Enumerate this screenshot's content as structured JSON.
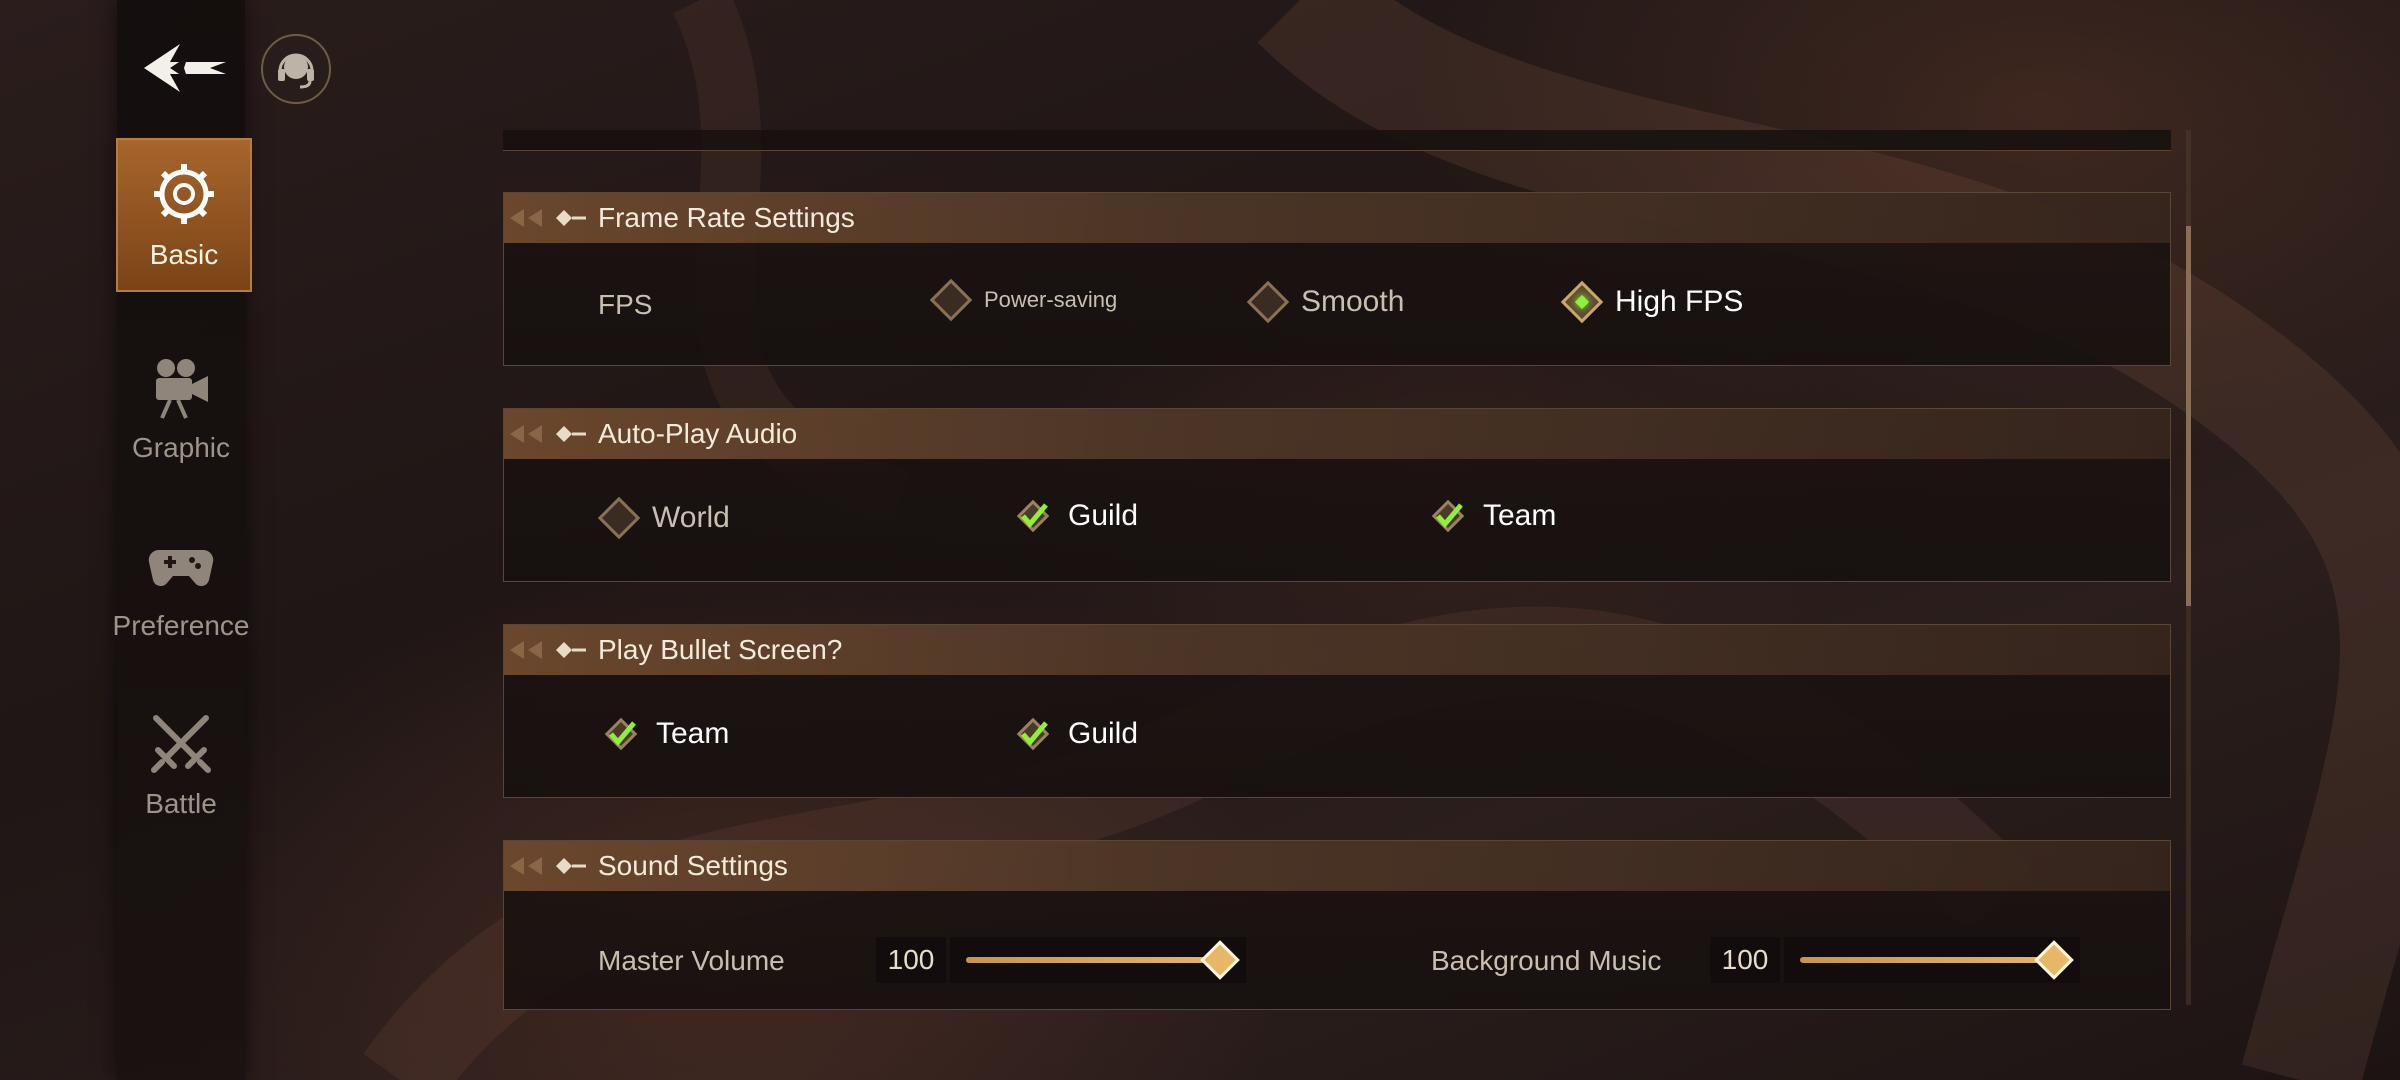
{
  "sidebar": {
    "items": [
      {
        "label": "Basic",
        "icon": "gear-icon",
        "active": true
      },
      {
        "label": "Graphic",
        "icon": "camera-icon",
        "active": false
      },
      {
        "label": "Preference",
        "icon": "gamepad-icon",
        "active": false
      },
      {
        "label": "Battle",
        "icon": "crossed-swords-icon",
        "active": false
      }
    ]
  },
  "header": {
    "back_icon": "back-arrow-icon",
    "support_icon": "headset-icon"
  },
  "frame_rate": {
    "title": "Frame Rate Settings",
    "row_label": "FPS",
    "options": [
      "Power-saving",
      "Smooth",
      "High FPS"
    ],
    "selected": "High FPS"
  },
  "auto_play_audio": {
    "title": "Auto-Play Audio",
    "options": [
      {
        "label": "World",
        "checked": false
      },
      {
        "label": "Guild",
        "checked": true
      },
      {
        "label": "Team",
        "checked": true
      }
    ]
  },
  "bullet_screen": {
    "title": "Play Bullet Screen?",
    "options": [
      {
        "label": "Team",
        "checked": true
      },
      {
        "label": "Guild",
        "checked": true
      }
    ]
  },
  "sound": {
    "title": "Sound Settings",
    "master_volume_label": "Master Volume",
    "master_volume_value": "100",
    "background_music_label": "Background Music",
    "background_music_value": "100"
  },
  "colors": {
    "accent": "#a8652c",
    "checked_green": "#8ff03c",
    "slider": "#e3b566"
  }
}
